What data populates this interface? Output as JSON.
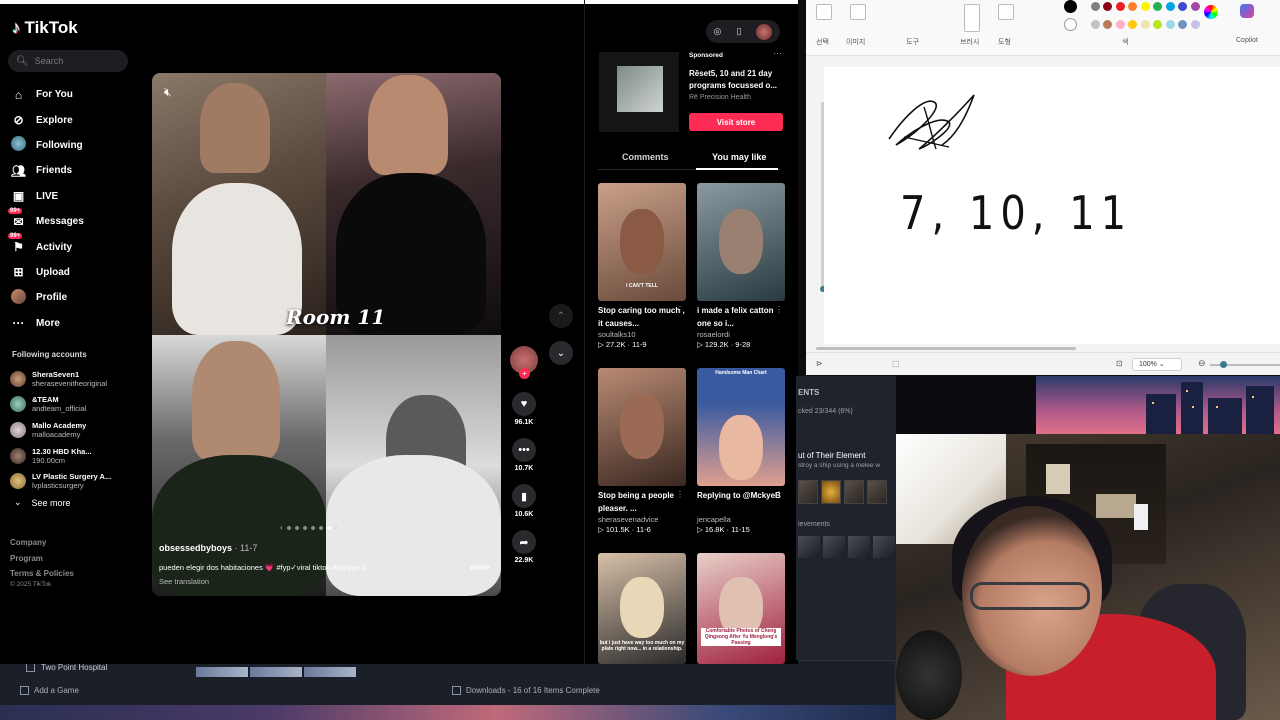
{
  "tiktok": {
    "logo": "TikTok",
    "search_placeholder": "Search",
    "nav": [
      {
        "label": "For You",
        "icon": "home-icon"
      },
      {
        "label": "Explore",
        "icon": "compass-icon"
      },
      {
        "label": "Following",
        "icon": "following-icon"
      },
      {
        "label": "Friends",
        "icon": "friends-icon"
      },
      {
        "label": "LIVE",
        "icon": "live-icon"
      },
      {
        "label": "Messages",
        "icon": "messages-icon",
        "badge": "99+"
      },
      {
        "label": "Activity",
        "icon": "activity-icon",
        "badge": "99+"
      },
      {
        "label": "Upload",
        "icon": "upload-icon"
      },
      {
        "label": "Profile",
        "icon": "profile-avatar"
      },
      {
        "label": "More",
        "icon": "more-icon"
      }
    ],
    "following_title": "Following accounts",
    "following": [
      {
        "name": "SheraSeven1",
        "handle": "sherasevenitheoriginal"
      },
      {
        "name": "&TEAM",
        "handle": "andteam_official"
      },
      {
        "name": "Mallo Academy",
        "handle": "malloacademy"
      },
      {
        "name": "12.30 HBD Kha...",
        "handle": "190.00cm"
      },
      {
        "name": "LV Plastic Surgery A...",
        "handle": "lvplasticsurgery"
      }
    ],
    "see_more": "See more",
    "footer": [
      "Company",
      "Program",
      "Terms & Policies"
    ],
    "copyright": "© 2025 TikTok",
    "video": {
      "overlay_text": "Room 11",
      "username": "obsessedbyboys",
      "date": " · 11-7",
      "caption": "pueden elegir dos habitaciones 💗 #fyp✓viral   tiktok #mytype #...",
      "more": "more",
      "see_translation": "See translation"
    },
    "actions": {
      "likes": "96.1K",
      "comments": "10.7K",
      "saves": "10.6K",
      "shares": "22.9K"
    },
    "sponsored": {
      "label": "Sponsored",
      "title": "Rēset5, 10 and 21 day programs focussed o...",
      "brand": "Rē Precision Health",
      "cta": "Visit store"
    },
    "tabs": {
      "comments": "Comments",
      "you_may_like": "You may like"
    },
    "cards": [
      {
        "caption": "Stop caring too much , it causes...",
        "user": "soultalks10",
        "stats": "▷ 27.2K · 11-9",
        "thumb_text": "I CAN'T TELL",
        "c1": "#6a4a3a",
        "c2": "#c9a08a"
      },
      {
        "caption": "i made a felix catton one so i...",
        "user": "rosaelordi",
        "stats": "▷ 129.2K · 9-28",
        "thumb_text": "",
        "c1": "#3a4a52",
        "c2": "#8a9aa0"
      },
      {
        "caption": "Stop being a people pleaser. ...",
        "user": "sherasevenadvice",
        "stats": "▷ 101.5K · 11-6",
        "thumb_text": "",
        "c1": "#5a4034",
        "c2": "#b98a74"
      },
      {
        "caption": "Replying to @MckyeB",
        "user": "jencapella",
        "stats": "▷ 16.8K · 11-15",
        "thumb_text": "Handsome Man Chart",
        "c1": "#3a5aa0",
        "c2": "#e0a090"
      },
      {
        "caption": "",
        "user": "",
        "stats": "",
        "thumb_text": "but i just have way too much on my plate right now... in a relationship.",
        "c1": "#2a2a2a",
        "c2": "#d8c0a8"
      },
      {
        "caption": "",
        "user": "",
        "stats": "",
        "thumb_text": "Comfortable Photos of Cheng Qingsong After Yu Menglong's Passing",
        "c1": "#a02040",
        "c2": "#e8d0c8"
      }
    ]
  },
  "paint": {
    "labels": [
      "선택",
      "이미지",
      "도구",
      "브러시",
      "도형",
      "색",
      "Copilot"
    ],
    "zoom": "100%",
    "drawing_text": "7, 10, 11",
    "colors": [
      "#000000",
      "#7f7f7f",
      "#880015",
      "#ed1c24",
      "#ff7f27",
      "#fff200",
      "#22b14c",
      "#00a2e8",
      "#3f48cc",
      "#a349a4",
      "#ffffff",
      "#c3c3c3",
      "#b97a57",
      "#ffaec9",
      "#ffc90e",
      "#efe4b0",
      "#b5e61d",
      "#99d9ea",
      "#7092be",
      "#c8bfe7"
    ]
  },
  "game": {
    "header": "ENTS",
    "progress": "cked 23/344 (6%)",
    "achievement_title": "ut of Their Element",
    "achievement_desc": "stroy a ship using a melee w",
    "section": "ievements"
  },
  "steam": {
    "game_name": "Two Point Hospital",
    "add_game": "Add a Game",
    "downloads": "Downloads - 16 of 16 Items Complete"
  }
}
